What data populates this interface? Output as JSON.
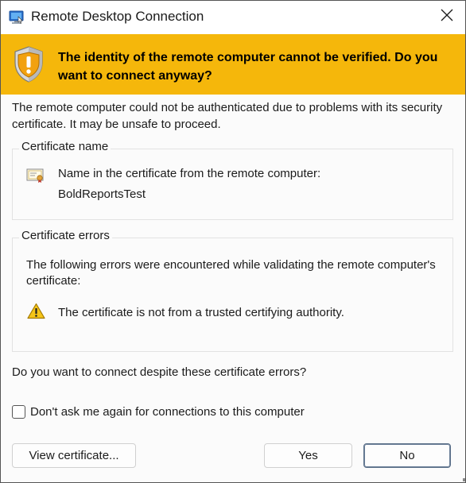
{
  "window": {
    "title": "Remote Desktop Connection",
    "close_icon": "close-icon"
  },
  "banner": {
    "text": "The identity of the remote computer cannot be verified. Do you want to connect anyway?",
    "icon": "shield-warning-icon",
    "color": "#f5b70b"
  },
  "intro_text": "The remote computer could not be authenticated due to problems with its security certificate. It may be unsafe to proceed.",
  "certificate_name": {
    "legend": "Certificate name",
    "label": "Name in the certificate from the remote computer:",
    "value": "BoldReportsTest",
    "icon": "certificate-icon"
  },
  "certificate_errors": {
    "legend": "Certificate errors",
    "intro": "The following errors were encountered while validating the remote computer's certificate:",
    "items": [
      {
        "icon": "warning-icon",
        "text": "The certificate is not from a trusted certifying authority."
      }
    ]
  },
  "question": "Do you want to connect despite these certificate errors?",
  "dont_ask": {
    "label": "Don't ask me again for connections to this computer",
    "checked": false
  },
  "buttons": {
    "view_certificate": "View certificate...",
    "yes": "Yes",
    "no": "No"
  }
}
